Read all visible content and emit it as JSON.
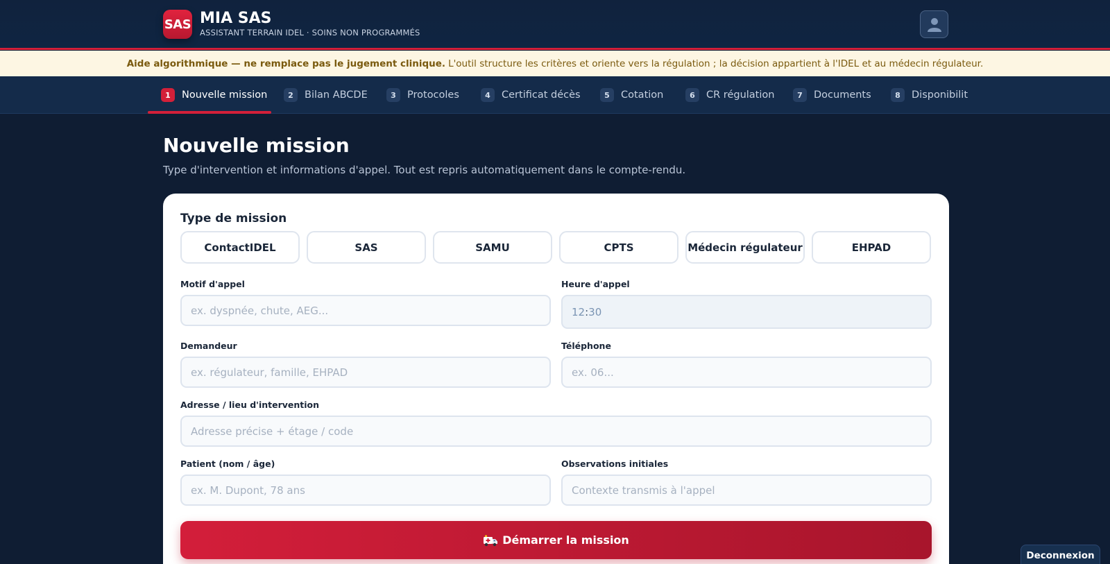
{
  "header": {
    "logo_text": "SAS",
    "title": "MIA SAS",
    "subtitle": "ASSISTANT TERRAIN IDEL · SOINS NON PROGRAMMÉS",
    "avatar_icon": "user-icon"
  },
  "disclaimer": {
    "bold": "Aide algorithmique — ne remplace pas le jugement clinique.",
    "text": "L'outil structure les critères et oriente vers la régulation ; la décision appartient à l'IDEL et au médecin régulateur."
  },
  "tabs": [
    {
      "num": "1",
      "label": "Nouvelle mission",
      "active": true
    },
    {
      "num": "2",
      "label": "Bilan ABCDE"
    },
    {
      "num": "3",
      "label": "Protocoles"
    },
    {
      "num": "4",
      "label": "Certificat décès"
    },
    {
      "num": "5",
      "label": "Cotation"
    },
    {
      "num": "6",
      "label": "CR régulation"
    },
    {
      "num": "7",
      "label": "Documents"
    },
    {
      "num": "8",
      "label": "Disponibilit"
    }
  ],
  "page": {
    "title": "Nouvelle mission",
    "subtitle": "Type d'intervention et informations d'appel. Tout est repris automatiquement dans le compte-rendu."
  },
  "form": {
    "type_label": "Type de mission",
    "types": [
      "ContactIDEL",
      "SAS",
      "SAMU",
      "CPTS",
      "Médecin régulateur",
      "EHPAD"
    ],
    "motif": {
      "label": "Motif d'appel",
      "placeholder": "ex. dyspnée, chute, AEG..."
    },
    "heure": {
      "label": "Heure d'appel",
      "hours": "12",
      "minutes": "30"
    },
    "demandeur": {
      "label": "Demandeur",
      "placeholder": "ex. régulateur, famille, EHPAD"
    },
    "telephone": {
      "label": "Téléphone",
      "placeholder": "ex. 06..."
    },
    "adresse": {
      "label": "Adresse / lieu d'intervention",
      "placeholder": "Adresse précise + étage / code"
    },
    "patient": {
      "label": "Patient (nom / âge)",
      "placeholder": "ex. M. Dupont, 78 ans"
    },
    "observations": {
      "label": "Observations initiales",
      "placeholder": "Contexte transmis à l'appel"
    },
    "start_label": "Démarrer la mission",
    "start_icon": "ambulance-icon"
  },
  "logout_label": "Deconnexion",
  "colors": {
    "accent": "#d32039",
    "background": "#0f1d33",
    "disclaimer_bg": "#fdf6e3"
  }
}
